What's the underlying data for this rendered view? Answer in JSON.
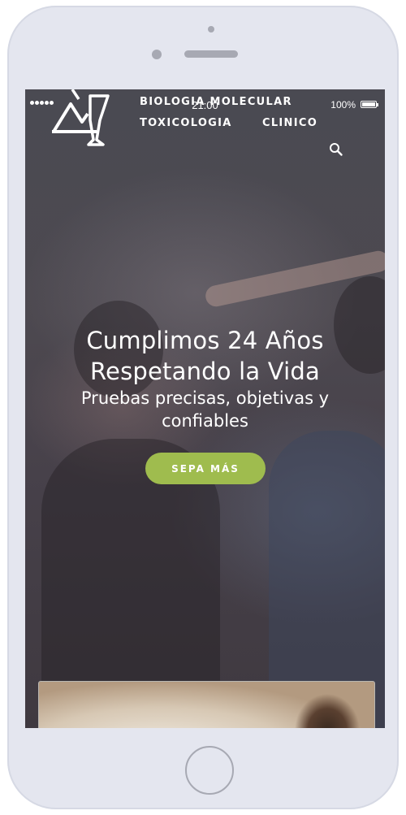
{
  "status_bar": {
    "time": "21:00",
    "battery_text": "100%",
    "battery_icon": "battery-full-icon",
    "signal_icon": "signal-dots-icon"
  },
  "header": {
    "logo_icon": "lab-logo-icon",
    "nav": [
      {
        "label": "BIOLOGIA MOLECULAR"
      },
      {
        "label": "TOXICOLOGIA"
      },
      {
        "label": "CLINICO"
      }
    ],
    "search_icon": "search-icon"
  },
  "hero": {
    "title_line1": "Cumplimos 24 Años",
    "title_line2": "Respetando la Vida",
    "subtitle_line1": "Pruebas precisas, objetivas y",
    "subtitle_line2": "confiables",
    "cta_label": "SEPA MÁS"
  },
  "colors": {
    "accent": "#9fbc4e",
    "device_frame": "#e4e6ef"
  }
}
